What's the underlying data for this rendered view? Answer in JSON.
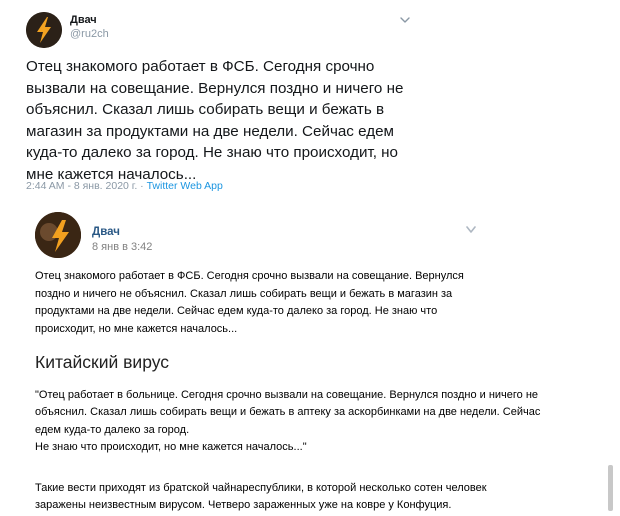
{
  "tweet": {
    "author_name": "Двач",
    "author_handle": "@ru2ch",
    "text": "Отец знакомого работает в ФСБ. Сегодня срочно вызвали на совещание. Вернулся поздно и ничего не объяснил. Сказал лишь собирать вещи и бежать в магазин за продуктами на две недели. Сейчас едем куда-то далеко за город. Не знаю что происходит, но мне кажется началось...",
    "meta_time": "2:44 AM - 8 янв. 2020 г. · ",
    "meta_source": "Twitter Web App",
    "icons": {
      "avatar": "lightning-logo",
      "menu": "chevron-down-icon"
    },
    "colors": {
      "link": "#1b95e0",
      "muted": "#8a98a5"
    }
  },
  "vk_post": {
    "author_name": "Двач",
    "date": "8 янв в 3:42",
    "text": "Отец знакомого работает в ФСБ. Сегодня срочно вызвали на совещание. Вернулся поздно и ничего не объяснил. Сказал лишь собирать вещи и бежать в магазин за продуктами на две недели. Сейчас едем куда-то далеко за город. Не знаю что происходит, но мне кажется началось...",
    "icons": {
      "avatar": "lightning-logo",
      "menu": "chevron-down-icon"
    },
    "colors": {
      "name": "#2a5885",
      "muted": "#828282"
    }
  },
  "article": {
    "title": "Китайский вирус",
    "quote_lines": [
      "\"Отец работает в больнице. Сегодня срочно вызвали на совещание. Вернулся поздно и ничего не",
      "объяснил. Сказал лишь собирать вещи и бежать в аптеку за аскорбинками на две недели. Сейчас",
      "едем куда-то далеко за город.",
      "Не знаю что происходит, но мне кажется началось...\""
    ],
    "body_lines": [
      "Такие вести приходят из братской чайнареспублики, в которой несколько сотен человек",
      "заражены неизвестным вирусом. Четверо зараженных уже на ковре у Конфуция."
    ]
  }
}
